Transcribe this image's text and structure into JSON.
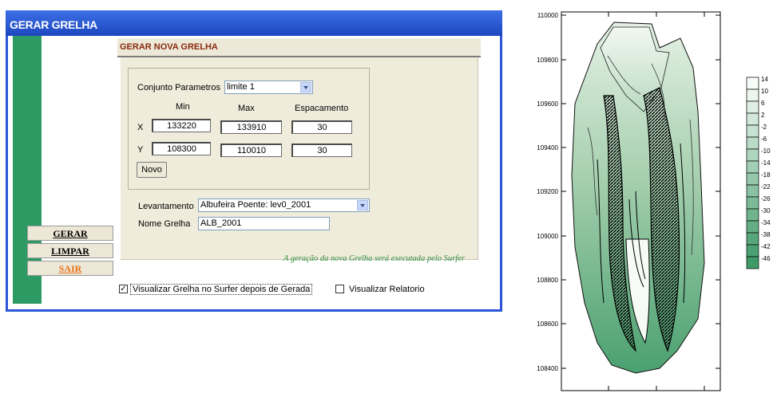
{
  "window": {
    "title": "GERAR GRELHA"
  },
  "panel": {
    "header": "GERAR NOVA GRELHA",
    "params_label": "Conjunto Parametros",
    "params_value": "limite 1",
    "col_min": "Min",
    "col_max": "Max",
    "col_spacing": "Espacamento",
    "row_x": {
      "label": "X",
      "min": "133220",
      "max": "133910",
      "spacing": "30"
    },
    "row_y": {
      "label": "Y",
      "min": "108300",
      "max": "110010",
      "spacing": "30"
    },
    "novo_label": "Novo",
    "survey_label": "Levantamento",
    "survey_value": "Albufeira Poente: lev0_2001",
    "grid_name_label": "Nome Grelha",
    "grid_name_value": "ALB_2001",
    "footnote": "A geração da nova Grelha será executada pelo Surfer"
  },
  "buttons": {
    "gerar": "GERAR",
    "limpar": "LIMPAR",
    "sair": "SAIR"
  },
  "options": {
    "view_grid": {
      "label": "Visualizar Grelha no Surfer depois de Gerada",
      "checked": true
    },
    "view_report": {
      "label": "Visualizar Relatorio",
      "checked": false
    }
  },
  "map": {
    "y_ticks": [
      "110000",
      "109800",
      "109600",
      "109400",
      "109200",
      "109000",
      "108800",
      "108600",
      "108400"
    ],
    "legend": [
      "14",
      "10",
      "6",
      "2",
      "-2",
      "-6",
      "-10",
      "-14",
      "-18",
      "-22",
      "-26",
      "-30",
      "-34",
      "-38",
      "-42",
      "-46"
    ],
    "colors": {
      "light": "#eef6ee",
      "dark": "#3f9a68"
    }
  },
  "colors": {
    "accent": "#2c55d8",
    "green_bar": "#2e9a63",
    "header_text": "#8a2a0e",
    "footnote": "#2e8b3e",
    "sair": "#e8731c"
  }
}
